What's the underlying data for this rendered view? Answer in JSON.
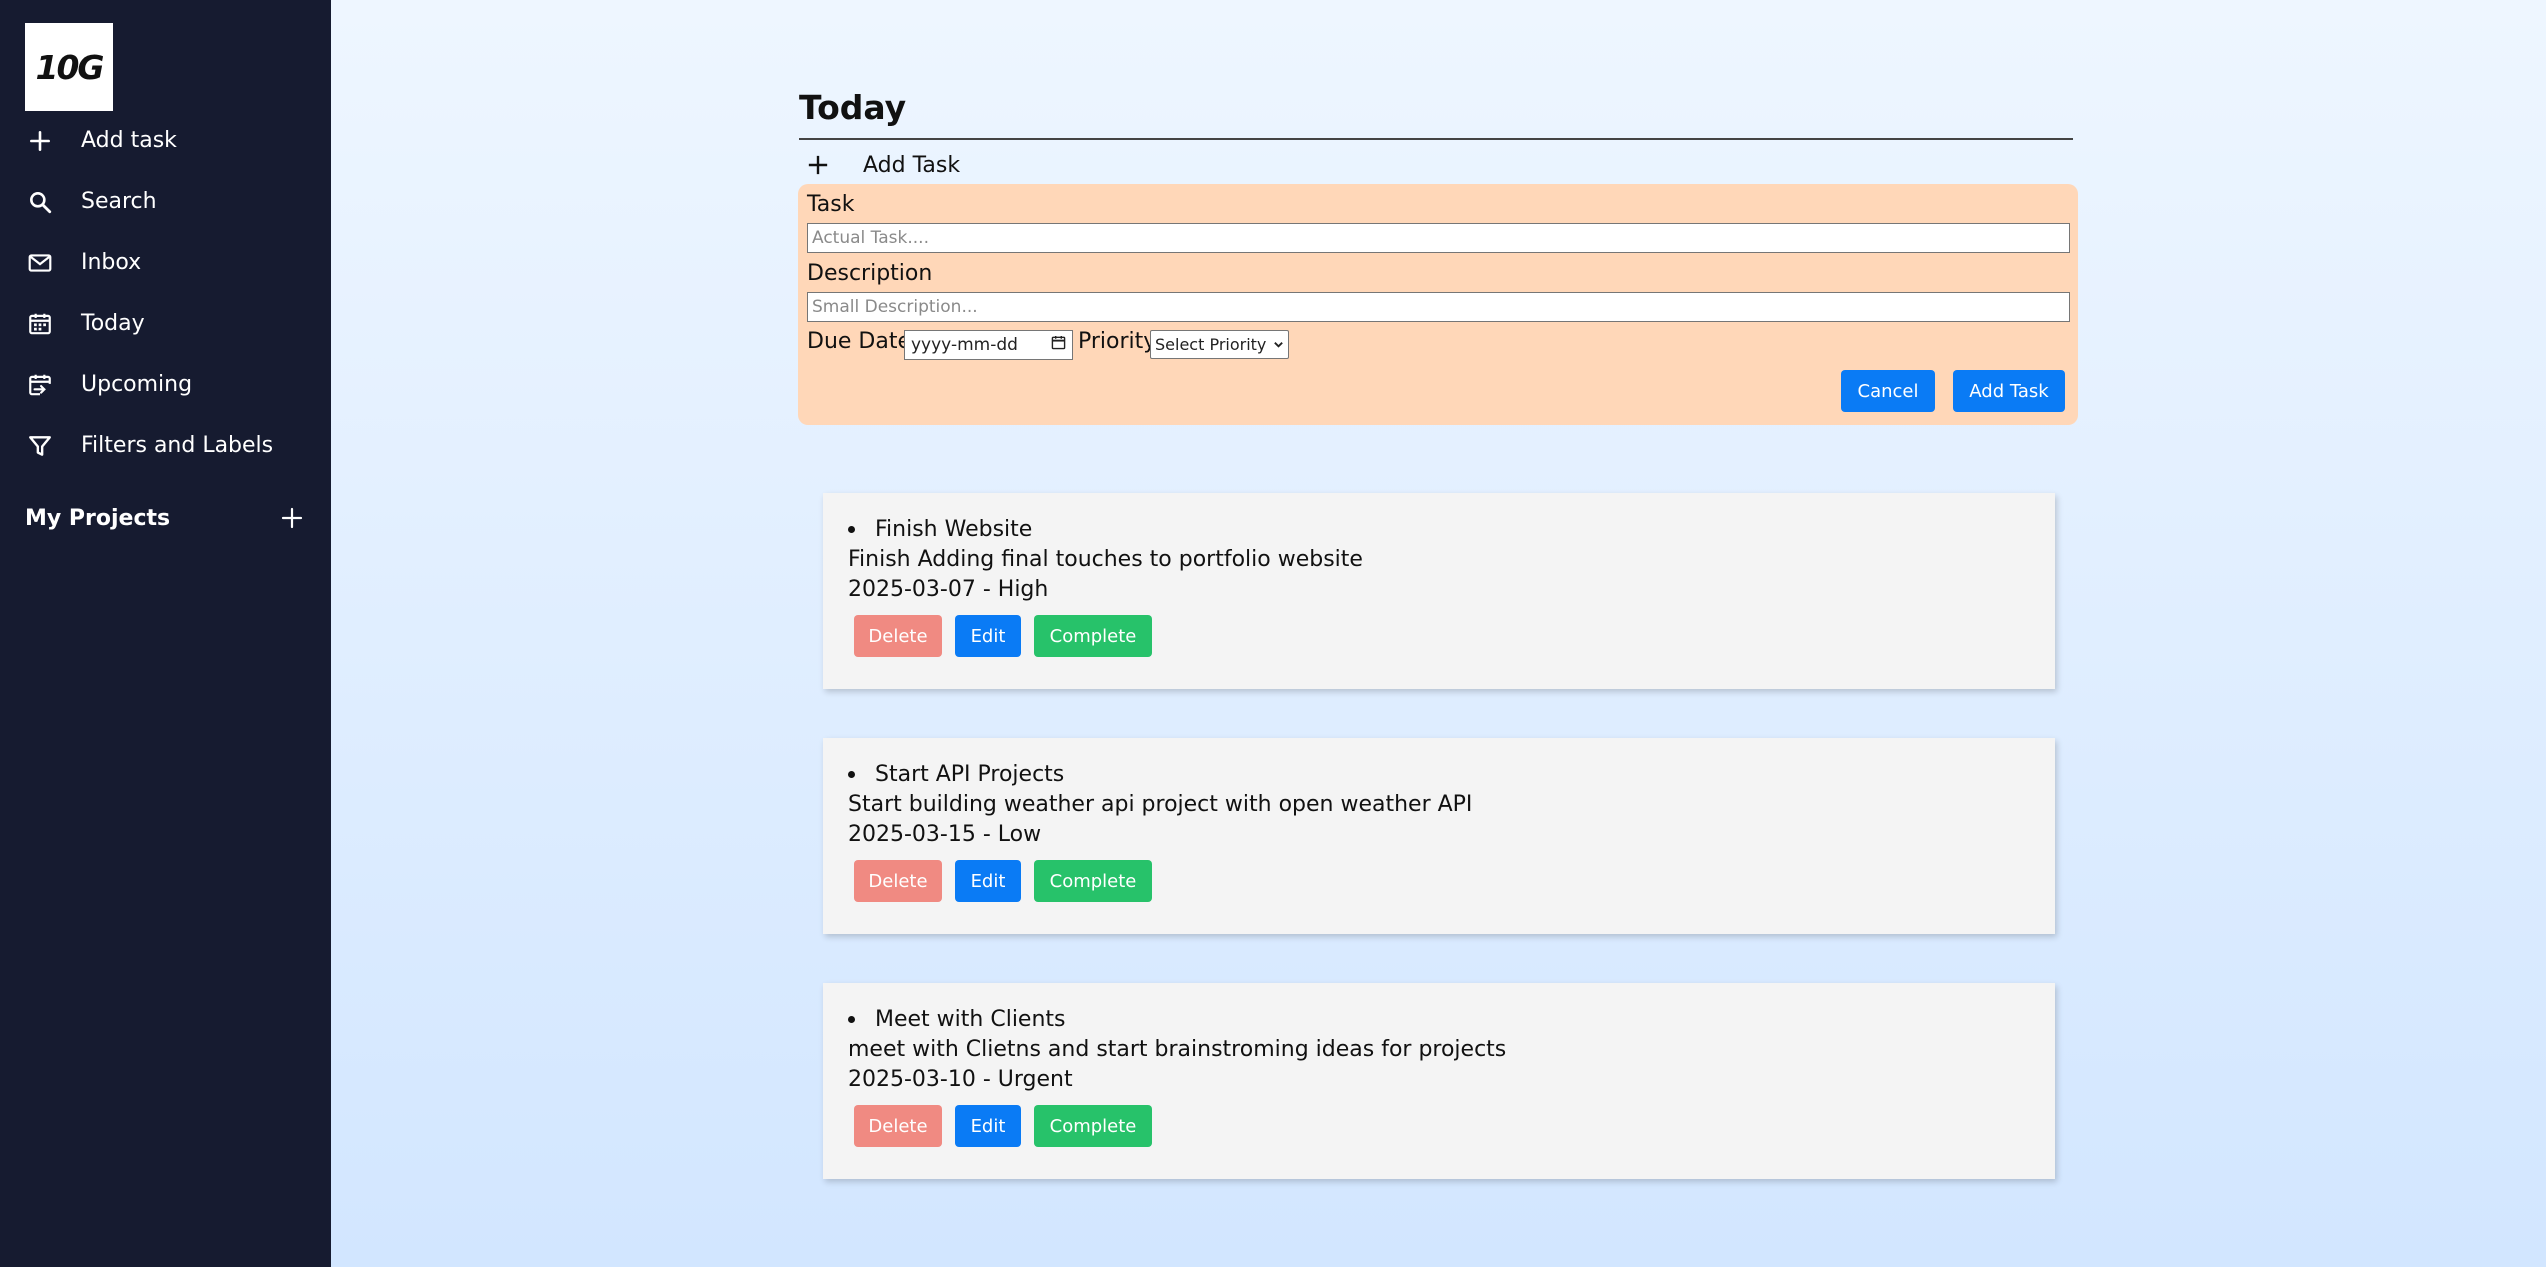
{
  "sidebar": {
    "logo": "10G",
    "items": [
      {
        "label": "Add task",
        "icon": "plus-icon"
      },
      {
        "label": "Search",
        "icon": "search-icon"
      },
      {
        "label": "Inbox",
        "icon": "mail-icon"
      },
      {
        "label": "Today",
        "icon": "calendar-icon"
      },
      {
        "label": "Upcoming",
        "icon": "calendar-arrow-icon"
      },
      {
        "label": "Filters and Labels",
        "icon": "filter-icon"
      }
    ],
    "projects_label": "My Projects"
  },
  "main": {
    "title": "Today",
    "add_task_label": "Add Task",
    "form": {
      "task_label": "Task",
      "task_placeholder": "Actual Task....",
      "description_label": "Description",
      "description_placeholder": "Small Description...",
      "due_date_label": "Due Date",
      "due_date_value": "yyyy-mm-dd",
      "priority_label": "Priority",
      "priority_value": "Select Priority",
      "cancel_label": "Cancel",
      "submit_label": "Add Task"
    },
    "tasks": [
      {
        "title": "Finish Website",
        "description": "Finish Adding final touches to portfolio website",
        "meta": "2025-03-07 - High",
        "delete_label": "Delete",
        "edit_label": "Edit",
        "complete_label": "Complete"
      },
      {
        "title": "Start API Projects",
        "description": "Start building weather api project with open weather API",
        "meta": "2025-03-15 - Low",
        "delete_label": "Delete",
        "edit_label": "Edit",
        "complete_label": "Complete"
      },
      {
        "title": "Meet with Clients",
        "description": "meet with Clietns and start brainstroming ideas for projects",
        "meta": "2025-03-10 - Urgent",
        "delete_label": "Delete",
        "edit_label": "Edit",
        "complete_label": "Complete"
      }
    ]
  },
  "colors": {
    "sidebar_bg": "#161b30",
    "form_bg": "#ffd7b8",
    "primary_blue": "#0a7bf5",
    "delete_red": "#f08a82",
    "complete_green": "#27c26a",
    "card_bg": "#f4f4f4"
  }
}
